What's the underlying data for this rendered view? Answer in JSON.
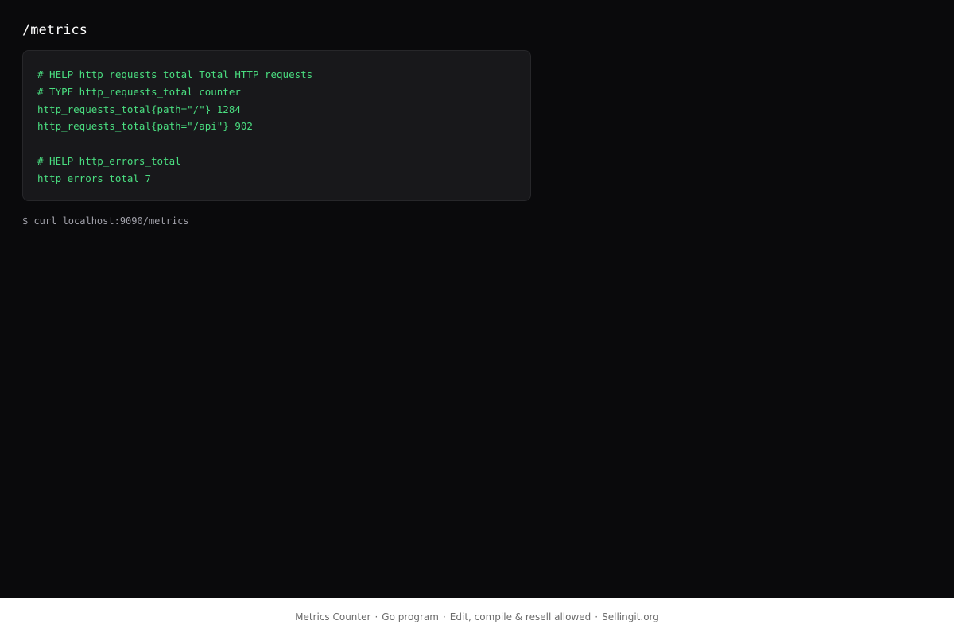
{
  "page": {
    "title": "/metrics"
  },
  "metrics": {
    "lines": [
      "# HELP http_requests_total Total HTTP requests",
      "# TYPE http_requests_total counter",
      "http_requests_total{path=\"/\"} 1284",
      "http_requests_total{path=\"/api\"} 902",
      "",
      "# HELP http_errors_total",
      "http_errors_total 7"
    ]
  },
  "terminal": {
    "command": "$ curl localhost:9090/metrics"
  },
  "footer": {
    "items": [
      "Metrics Counter",
      "Go program",
      "Edit, compile & resell allowed",
      "Sellingit.org"
    ],
    "separator": "·"
  },
  "colors": {
    "background": "#0a0a0c",
    "panel": "#18181b",
    "metric_text": "#4ade80",
    "footer_bg": "#ffffff"
  }
}
